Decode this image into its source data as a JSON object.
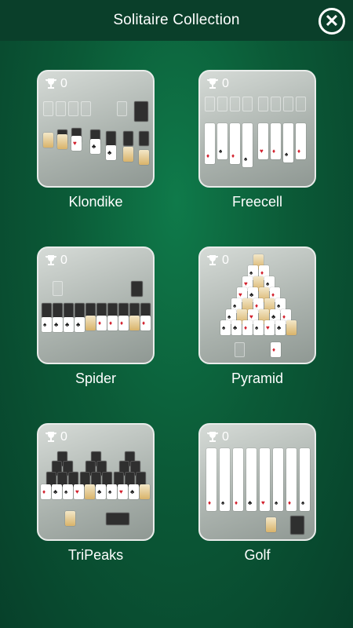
{
  "header": {
    "title": "Solitaire Collection",
    "close_icon": "close-icon"
  },
  "games": [
    {
      "name": "Klondike",
      "score": "0"
    },
    {
      "name": "Freecell",
      "score": "0"
    },
    {
      "name": "Spider",
      "score": "0"
    },
    {
      "name": "Pyramid",
      "score": "0"
    },
    {
      "name": "TriPeaks",
      "score": "0"
    },
    {
      "name": "Golf",
      "score": "0"
    }
  ],
  "colors": {
    "background": "#0b5a37",
    "header": "#0a3f2a",
    "accent": "#ffffff"
  }
}
